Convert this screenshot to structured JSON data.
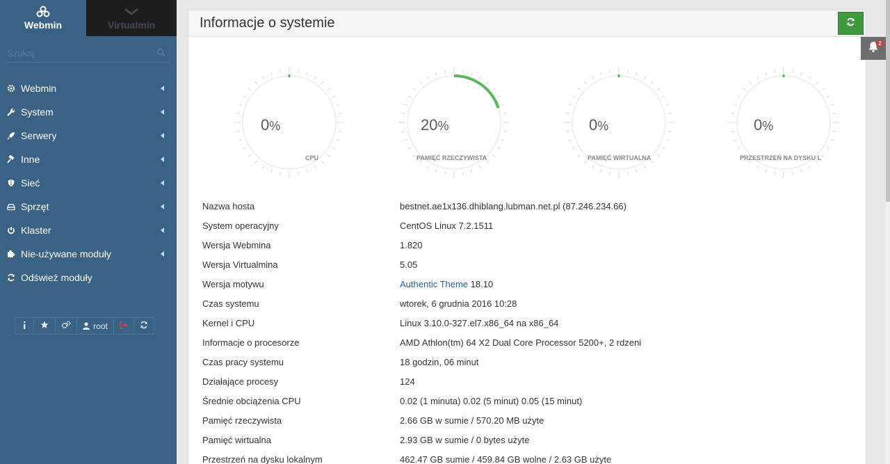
{
  "sidebar": {
    "tabs": [
      {
        "label": "Webmin",
        "icon": "webmin-logo-icon"
      },
      {
        "label": "Virtualmin",
        "icon": "virtualmin-logo-icon"
      }
    ],
    "search_placeholder": "Szukaj",
    "menu": [
      {
        "label": "Webmin",
        "icon": "gear-icon"
      },
      {
        "label": "System",
        "icon": "wrench-icon"
      },
      {
        "label": "Serwery",
        "icon": "rocket-icon"
      },
      {
        "label": "Inne",
        "icon": "hammer-icon"
      },
      {
        "label": "Sieć",
        "icon": "shield-icon"
      },
      {
        "label": "Sprzęt",
        "icon": "hdd-icon"
      },
      {
        "label": "Klaster",
        "icon": "power-icon"
      },
      {
        "label": "Nie-używane moduły",
        "icon": "puzzle-icon"
      },
      {
        "label": "Odśwież moduły",
        "icon": "refresh-icon"
      }
    ],
    "tools": {
      "user": "root"
    }
  },
  "panel": {
    "title": "Informacje o systemie"
  },
  "gauges": [
    {
      "value": "0",
      "unit": "%",
      "label": "CPU",
      "fraction": 0.0
    },
    {
      "value": "20",
      "unit": "%",
      "label": "PAMIĘĆ RZECZYWISTA",
      "fraction": 0.2
    },
    {
      "value": "0",
      "unit": "%",
      "label": "PAMIĘĆ WIRTUALNA",
      "fraction": 0.0
    },
    {
      "value": "0",
      "unit": "%",
      "label": "PRZESTRZEŃ NA DYSKU L",
      "fraction": 0.0
    }
  ],
  "info": [
    {
      "key": "Nazwa hosta",
      "value": "bestnet.ae1x136.dhiblang.lubman.net.pl (87.246.234.66)",
      "link": true
    },
    {
      "key": "System operacyjny",
      "value": "CentOS Linux 7.2.1511",
      "link": false
    },
    {
      "key": "Wersja Webmina",
      "value": "1.820",
      "link": false
    },
    {
      "key": "Wersja Virtualmina",
      "value": "5.05",
      "link": false
    },
    {
      "key": "Wersja motywu",
      "value": "Authentic Theme",
      "value_suffix": " 18.10",
      "link": true
    },
    {
      "key": "Czas systemu",
      "value": "wtorek, 6 grudnia 2016 10:28",
      "link": true
    },
    {
      "key": "Kernel i CPU",
      "value": "Linux 3.10.0-327.el7.x86_64 na x86_64",
      "link": false
    },
    {
      "key": "Informacje o procesorze",
      "value": "AMD Athlon(tm) 64 X2 Dual Core Processor 5200+, 2 rdzeni",
      "link": false
    },
    {
      "key": "Czas pracy systemu",
      "value": "18 godzin, 06 minut",
      "link": true
    },
    {
      "key": "Działające procesy",
      "value": "124",
      "link": true
    },
    {
      "key": "Średnie obciążenia CPU",
      "value": "0.02 (1 minuta) 0.02 (5 minut) 0.05 (15 minut)",
      "link": false
    },
    {
      "key": "Pamięć rzeczywista",
      "value": "2.66 GB w sumie / 570.20 MB użyte",
      "link": false
    },
    {
      "key": "Pamięć wirtualna",
      "value": "2.93 GB w sumie / 0 bytes użyte",
      "link": false
    },
    {
      "key": "Przestrzeń na dysku lokalnym",
      "value": "462.47 GB sumie / 459.84 GB wolne / 2.63 GB użyte",
      "link": false
    }
  ],
  "notifications": {
    "count": "2"
  },
  "colors": {
    "sidebar": "#3a6285",
    "accent": "#3e9a3c",
    "link": "#2c5f99"
  }
}
